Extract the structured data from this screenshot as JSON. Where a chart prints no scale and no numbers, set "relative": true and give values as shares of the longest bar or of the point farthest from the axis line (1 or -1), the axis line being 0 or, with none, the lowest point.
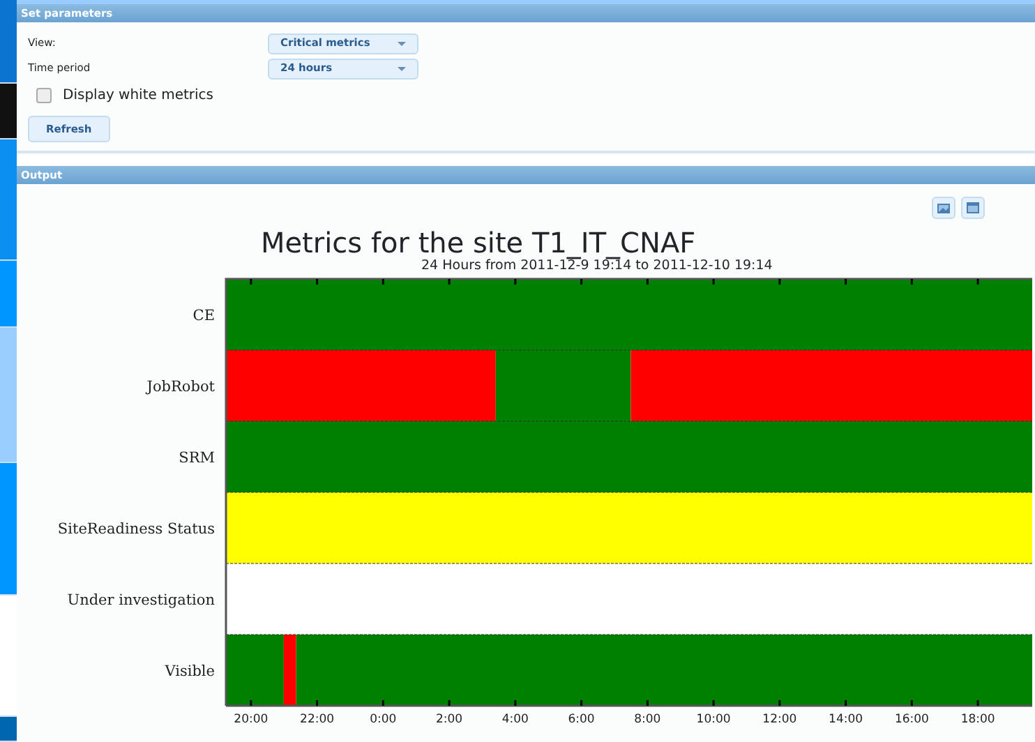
{
  "parameters_panel": {
    "title": "Set parameters",
    "fields": [
      {
        "label": "View:",
        "value": "Critical metrics"
      },
      {
        "label": "Time period",
        "value": "24 hours"
      }
    ],
    "checkbox": {
      "label": "Display white metrics",
      "checked": false
    },
    "button": "Refresh"
  },
  "output_panel": {
    "title": "Output",
    "subtitle": "24 Hours from 2011-12-9 19:14 to 2011-12-10 19:14",
    "chart_data": {
      "type": "bar",
      "orientation": "horizontal",
      "stacked": true,
      "title": "Metrics for the site T1_IT_CNAF",
      "categories": [
        "CE",
        "JobRobot",
        "SRM",
        "SiteReadiness Status",
        "Under investigation",
        "Visible"
      ],
      "relative": true,
      "series": [
        {
          "color": "#008000",
          "values": [
            1,
            null,
            1,
            null,
            null,
            0.0717
          ]
        },
        {
          "color": "#ff0000",
          "values": [
            null,
            0.3346,
            null,
            null,
            null,
            0.0154
          ]
        },
        {
          "color": "#008000",
          "values": [
            null,
            0.1675,
            null,
            null,
            null,
            0.9129
          ]
        },
        {
          "color": "#ff0000",
          "values": [
            null,
            0.4979,
            null,
            null,
            null,
            null
          ]
        },
        {
          "color": "#ffff00",
          "values": [
            null,
            null,
            null,
            1,
            null,
            null
          ]
        }
      ]
    },
    "time_axis_labels": [
      "20:00",
      "22:00",
      "0:00",
      "2:00",
      "4:00",
      "6:00",
      "8:00",
      "10:00",
      "12:00",
      "14:00",
      "16:00",
      "18:00"
    ]
  }
}
